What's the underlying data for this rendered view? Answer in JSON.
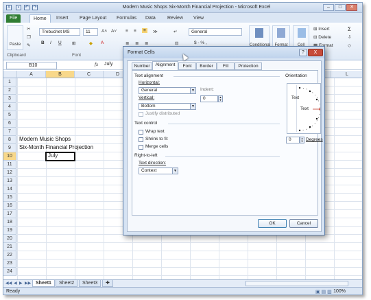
{
  "window": {
    "title": "Modern Music Shops Six-Month Financial Projection - Microsoft Excel"
  },
  "ribbon": {
    "tabs": [
      "File",
      "Home",
      "Insert",
      "Page Layout",
      "Formulas",
      "Data",
      "Review",
      "View"
    ],
    "font_name": "Trebuchet MS",
    "font_size": "11",
    "number_format": "General",
    "paste_label": "Paste",
    "clipboard_label": "Clipboard",
    "font_group_label": "Font",
    "conditional_label": "Conditional",
    "format_label": "Format",
    "cell_label": "Cell",
    "insert_label": "Insert",
    "delete_label": "Delete",
    "format_menu_label": "Format"
  },
  "formula_bar": {
    "name_box": "B10",
    "fx": "fx",
    "content": "July"
  },
  "grid": {
    "columns": [
      "A",
      "B",
      "C",
      "D",
      "L"
    ],
    "rows": [
      "1",
      "2",
      "3",
      "4",
      "5",
      "6",
      "7",
      "8",
      "9",
      "10",
      "11",
      "12",
      "13",
      "14",
      "15",
      "16",
      "17",
      "18",
      "19",
      "20",
      "21",
      "22",
      "23",
      "24"
    ],
    "cells": {
      "a8": "Modern Music Shops",
      "a9": "Six-Month Financial Projection",
      "b10": "July"
    }
  },
  "sheets": {
    "tabs": [
      "Sheet1",
      "Sheet2",
      "Sheet3"
    ]
  },
  "status": {
    "ready": "Ready",
    "zoom": "100%"
  },
  "dialog": {
    "title": "Format Cells",
    "help": "?",
    "close": "X",
    "tabs": [
      "Number",
      "Alignment",
      "Font",
      "Border",
      "Fill",
      "Protection"
    ],
    "text_alignment": "Text alignment",
    "horizontal_label": "Horizontal:",
    "horizontal_value": "General",
    "indent_label": "Indent:",
    "indent_value": "0",
    "vertical_label": "Vertical:",
    "vertical_value": "Bottom",
    "justify_distributed": "Justify distributed",
    "text_control": "Text control",
    "wrap_text": "Wrap text",
    "shrink_to_fit": "Shrink to fit",
    "merge_cells": "Merge cells",
    "right_to_left": "Right-to-left",
    "text_direction_label": "Text direction:",
    "text_direction_value": "Context",
    "orientation": "Orientation",
    "orientation_vertical_text": "Text",
    "orientation_horizontal_text": "Text",
    "degrees_value": "0",
    "degrees_label": "Degrees",
    "ok": "OK",
    "cancel": "Cancel"
  }
}
